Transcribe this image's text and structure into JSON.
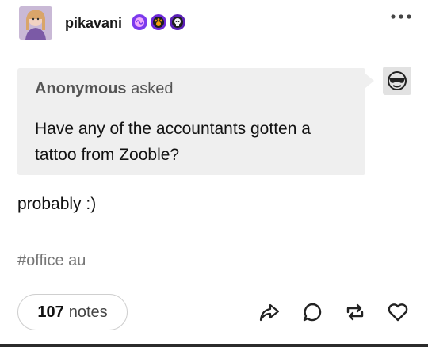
{
  "header": {
    "username": "pikavani",
    "avatar_icon": "user-avatar",
    "badges": [
      {
        "name": "purple-brain-badge-icon",
        "color": "#8b5cf6"
      },
      {
        "name": "paw-badge-icon",
        "color": "#6b46c1"
      },
      {
        "name": "skull-badge-icon",
        "color": "#4c1d95"
      }
    ],
    "more_icon": "ellipsis-icon"
  },
  "ask": {
    "asker": "Anonymous",
    "asked_label": "asked",
    "question": "Have any of the accountants gotten a tattoo from Zooble?",
    "anon_avatar_icon": "sunglasses-smiley-icon"
  },
  "answer": "probably :)",
  "tag": "#office au",
  "footer": {
    "notes_count": "107",
    "notes_label": "notes",
    "actions": [
      "share-icon",
      "reply-icon",
      "reblog-icon",
      "like-icon"
    ]
  }
}
